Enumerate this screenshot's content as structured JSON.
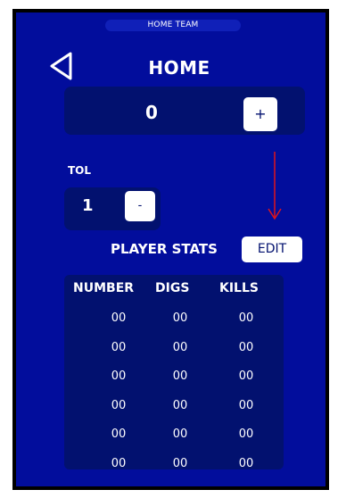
{
  "header": {
    "team_pill": "HOME TEAM",
    "title": "HOME",
    "back_icon": "back-triangle-icon"
  },
  "score": {
    "value": "0",
    "increment_label": "+"
  },
  "tol": {
    "label": "TOL",
    "value": "1",
    "decrement_label": "-"
  },
  "annotation": {
    "arrow_color": "#e0151b",
    "arrow_icon": "down-arrow-icon"
  },
  "player_stats": {
    "title": "PLAYER STATS",
    "edit_label": "EDIT",
    "columns": [
      "NUMBER",
      "DIGS",
      "KILLS"
    ],
    "rows": [
      [
        "00",
        "00",
        "00"
      ],
      [
        "00",
        "00",
        "00"
      ],
      [
        "00",
        "00",
        "00"
      ],
      [
        "00",
        "00",
        "00"
      ],
      [
        "00",
        "00",
        "00"
      ],
      [
        "00",
        "00",
        "00"
      ]
    ]
  },
  "colors": {
    "background": "#020d9c",
    "card": "#02116f",
    "button": "#ffffff"
  }
}
